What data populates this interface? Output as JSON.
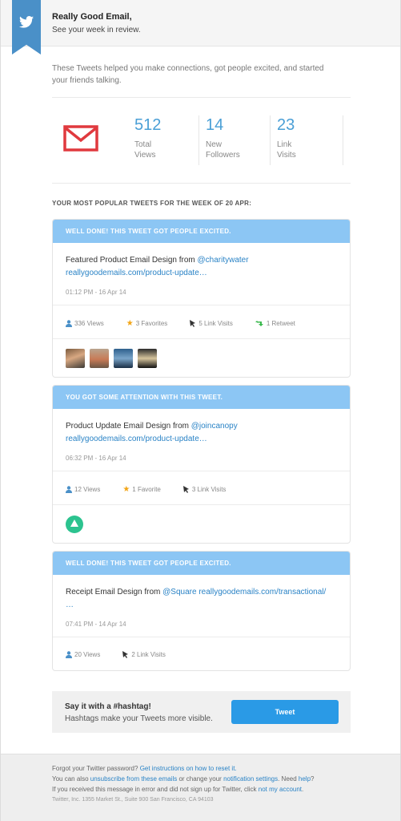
{
  "header": {
    "title": "Really Good Email,",
    "subtitle": "See your week in review."
  },
  "intro": "These Tweets helped you make connections, got people excited, and started your friends talking.",
  "stats": [
    {
      "value": "512",
      "label_line1": "Total",
      "label_line2": "Views"
    },
    {
      "value": "14",
      "label_line1": "New",
      "label_line2": "Followers"
    },
    {
      "value": "23",
      "label_line1": "Link",
      "label_line2": "Visits"
    }
  ],
  "section_title": "YOUR MOST POPULAR TWEETS FOR THE WEEK OF 20 APR:",
  "tweets": [
    {
      "heading": "WELL DONE! THIS TWEET GOT PEOPLE EXCITED.",
      "text": "Featured Product Email Design from ",
      "mention": "@charitywater",
      "link": "reallygoodemails.com/product-update…",
      "time": "01:12 PM - 16 Apr 14",
      "views": "336 Views",
      "favorites": "3 Favorites",
      "link_visits": "5 Link Visits",
      "retweets": "1 Retweet"
    },
    {
      "heading": "YOU GOT SOME ATTENTION WITH THIS TWEET.",
      "text": "Product Update Email Design from ",
      "mention": "@joincanopy",
      "link": "reallygoodemails.com/product-update…",
      "time": "06:32 PM - 16 Apr 14",
      "views": "12 Views",
      "favorites": "1 Favorite",
      "link_visits": "3 Link Visits"
    },
    {
      "heading": "WELL DONE! THIS TWEET GOT PEOPLE EXCITED.",
      "text": "Receipt Email Design from ",
      "mention": "@Square",
      "link": "reallygoodemails.com/transactional/",
      "link2": "…",
      "time": "07:41 PM - 14 Apr 14",
      "views": "20 Views",
      "link_visits": "2 Link Visits"
    }
  ],
  "hashtag": {
    "title": "Say it with a #hashtag!",
    "subtitle": "Hashtags make your Tweets more visible.",
    "button": "Tweet"
  },
  "footer": {
    "l1_text": "Forgot your Twitter password? ",
    "l1_link": "Get instructions on how to reset it.",
    "l2_a": "You can also ",
    "l2_link1": "unsubscribe from these emails",
    "l2_b": " or change your ",
    "l2_link2": "notification settings",
    "l2_c": ". Need ",
    "l2_link3": "help",
    "l2_d": "?",
    "l3_text": "If you received this message in error and did not sign up for Twitter, click ",
    "l3_link": "not my account",
    "l3_end": ".",
    "address": "Twitter, Inc. 1355 Market St., Suite 900 San Francisco, CA 94103"
  },
  "colors": {
    "accent": "#4a9fd6",
    "card_header": "#8cc6f4",
    "button": "#2a9ae6",
    "envelope": "#e0393e",
    "ribbon": "#4a90c8"
  }
}
